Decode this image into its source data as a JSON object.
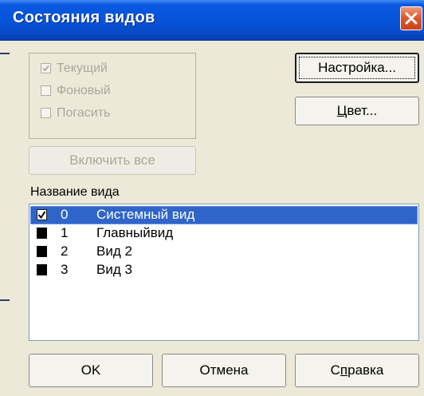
{
  "window": {
    "title": "Состояния видов"
  },
  "options": [
    {
      "label": "Текущий",
      "checked": true
    },
    {
      "label": "Фоновый",
      "checked": false
    },
    {
      "label": "Погасить",
      "checked": false
    }
  ],
  "buttons": {
    "setup": {
      "label": "Настройка..."
    },
    "color": {
      "label_prefix": "",
      "accel": "Ц",
      "label_rest": "вет..."
    },
    "enable_all": {
      "label": "Включить все"
    },
    "ok": {
      "label": "OK"
    },
    "cancel": {
      "label": "Отмена"
    },
    "help": {
      "label_prefix": "С",
      "accel": "п",
      "label_rest": "равка"
    }
  },
  "list": {
    "label": "Название вида",
    "items": [
      {
        "number": "0",
        "name": "Системный вид",
        "selected": true,
        "checked": true
      },
      {
        "number": "1",
        "name": "Главныйвид",
        "selected": false,
        "checked": false
      },
      {
        "number": "2",
        "name": "Вид 2",
        "selected": false,
        "checked": false
      },
      {
        "number": "3",
        "name": "Вид 3",
        "selected": false,
        "checked": false
      }
    ]
  },
  "colors": {
    "titlebar": "#0553d9",
    "selection": "#2f65c9",
    "dialog_bg": "#ece9d8",
    "close_button": "#e05a2c"
  }
}
